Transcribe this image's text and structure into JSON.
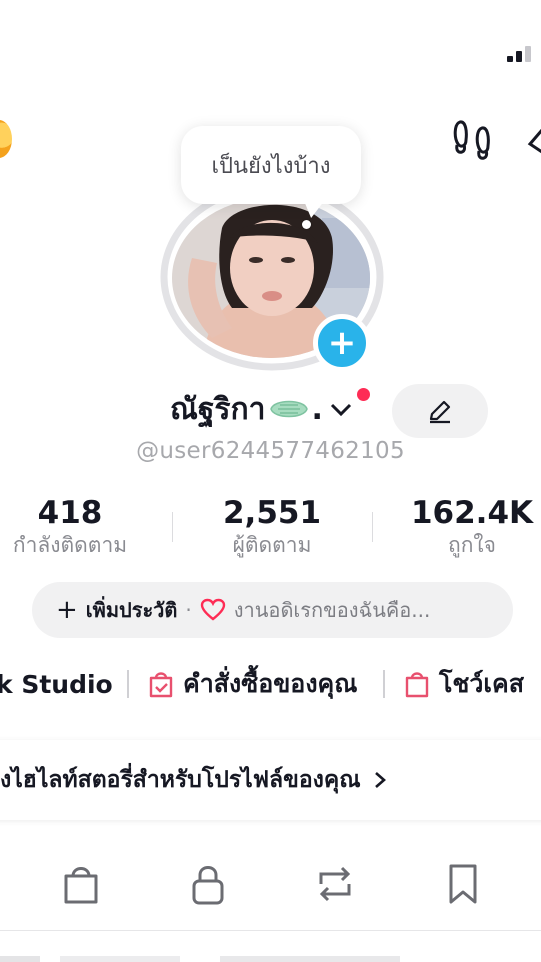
{
  "header": {
    "signal_icon": "signal-icon",
    "coin_icon": "coin-icon",
    "footprint_icon": "footprint-icon"
  },
  "profile": {
    "status_bubble": "เป็นยังไงบ้าง",
    "display_name": "ณัฐริกา",
    "name_suffix": ".",
    "username": "@user6244577462105",
    "add_photo_symbol": "+"
  },
  "stats": [
    {
      "value": "418",
      "label": "กำลังติดตาม"
    },
    {
      "value": "2,551",
      "label": "ผู้ติดตาม"
    },
    {
      "value": "162.4K",
      "label": "ถูกใจ"
    }
  ],
  "bio": {
    "add_symbol": "+",
    "add_label": "เพิ่มประวัติ",
    "separator": "·",
    "text": "งานอดิเรกของฉันคือ..."
  },
  "links": {
    "studio": "k Studio",
    "orders": "คำสั่งซื้อของคุณ",
    "showcase": "โชว์เคส"
  },
  "highlight": {
    "text": "งไฮไลท์สตอรี่สำหรับโปรไฟล์ของคุณ"
  },
  "tabs": [
    "shopping-bag-icon",
    "lock-icon",
    "repost-icon",
    "bookmark-icon"
  ],
  "colors": {
    "accent_red": "#fe2c55",
    "plus_blue": "#29b3ea",
    "pill_gray": "#f1f1f2"
  }
}
